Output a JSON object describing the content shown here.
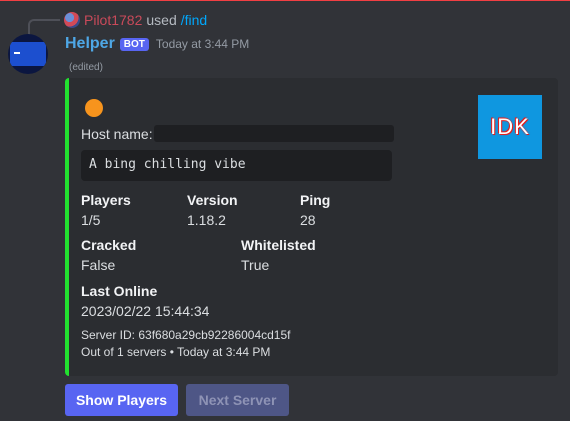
{
  "reply": {
    "user": "Pilot1782",
    "used": "used",
    "command": "/find"
  },
  "message": {
    "author": "Helper",
    "bot_tag": "BOT",
    "timestamp": "Today at 3:44 PM",
    "edited": "(edited)"
  },
  "embed": {
    "accent_color": "#22e12f",
    "status_dot_color": "#f7941d",
    "host_label": "Host name:",
    "host_value": "",
    "motd": "A bing chilling vibe",
    "thumbnail_text": "IDK",
    "fields": {
      "players": {
        "name": "Players",
        "value": "1/5"
      },
      "version": {
        "name": "Version",
        "value": "1.18.2"
      },
      "ping": {
        "name": "Ping",
        "value": "28"
      },
      "cracked": {
        "name": "Cracked",
        "value": "False"
      },
      "whitelisted": {
        "name": "Whitelisted",
        "value": "True"
      },
      "last_online": {
        "name": "Last Online",
        "value": "2023/02/22 15:44:34"
      }
    },
    "server_id": "Server ID: 63f680a29cb92286004cd15f",
    "footer": "Out of 1 servers • Today at 3:44 PM"
  },
  "buttons": {
    "show_players": "Show Players",
    "next_server": "Next Server"
  }
}
